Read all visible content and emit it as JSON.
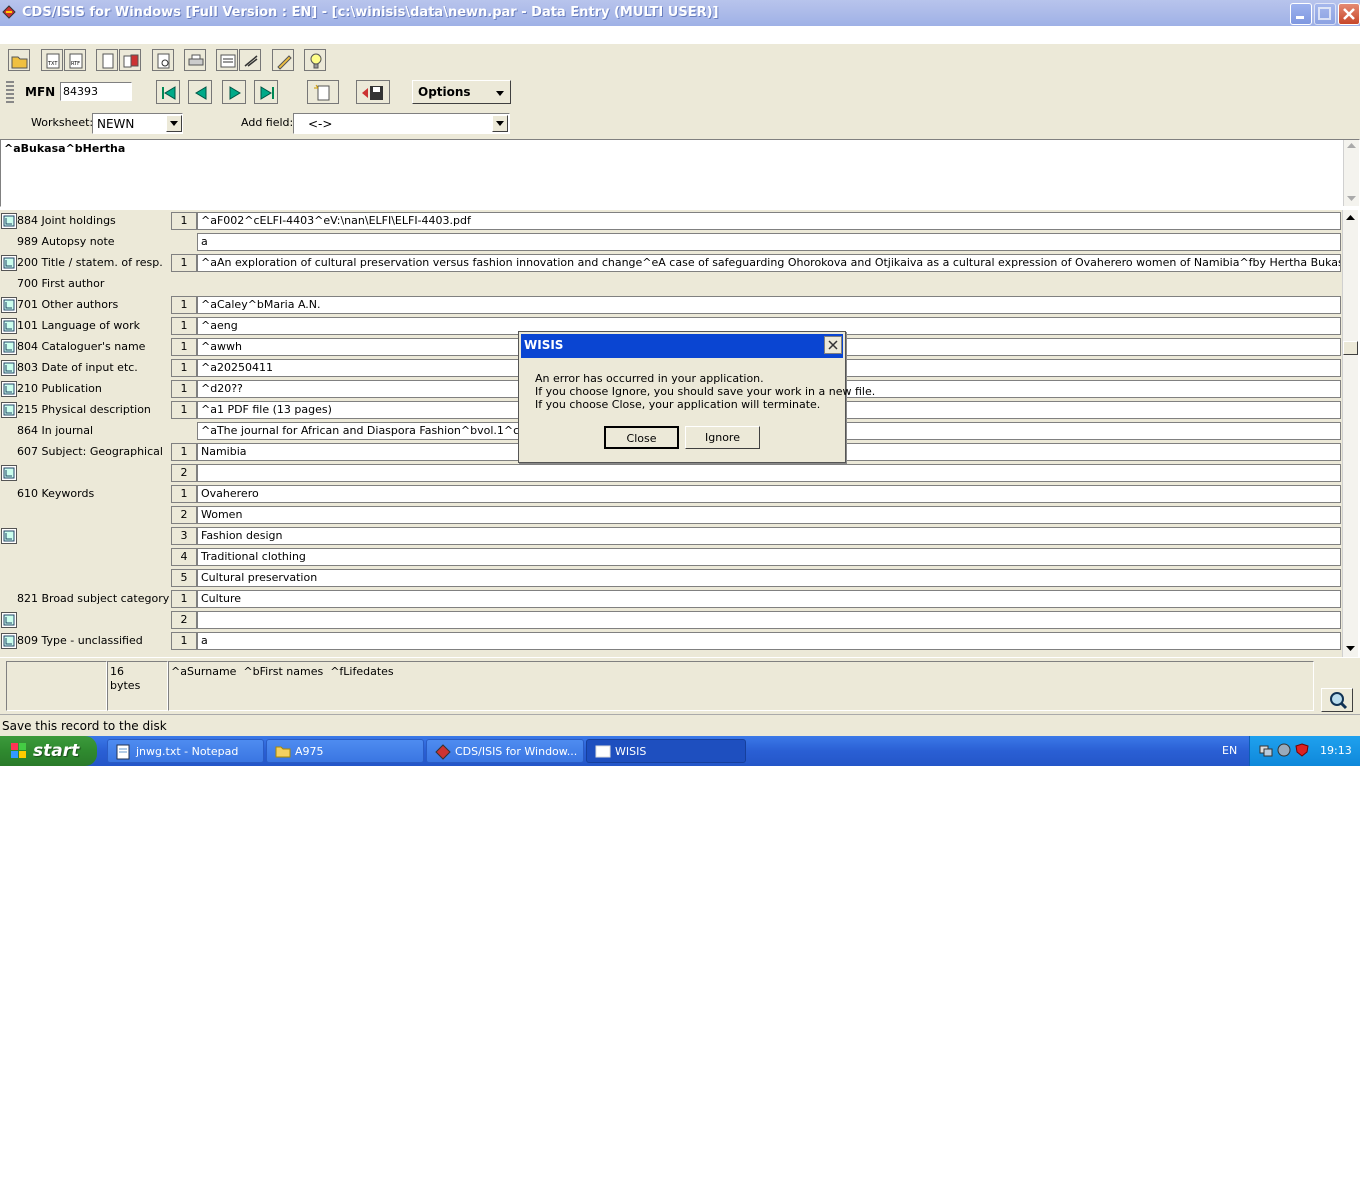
{
  "window": {
    "title": "CDS/ISIS for Windows [Full Version : EN] - [c:\\winisis\\data\\newn.par - Data Entry (MULTI USER)]"
  },
  "toolbar": {
    "mfn_label": "MFN",
    "mfn_value": "84393",
    "options_label": "Options",
    "worksheet_label": "Worksheet:",
    "worksheet_value": "NEWN",
    "addfield_label": "Add field:",
    "addfield_value": "<->"
  },
  "editor": {
    "text": "^aBukasa^bHertha"
  },
  "fields": [
    {
      "label": "884 Joint holdings",
      "occ": "1",
      "value": "^aF002^cELFI-4403^eV:\\nan\\ELFI\\ELFI-4403.pdf",
      "icon": true
    },
    {
      "label": "989 Autopsy note",
      "occ": "",
      "value": "a",
      "icon": false
    },
    {
      "label": "200 Title / statem. of resp.",
      "occ": "1",
      "value": "^aAn exploration of cultural preservation versus fashion innovation and change^eA case of safeguarding Ohorokova and Otjikaiva as a cultural expression of Ovaherero women of Namibia^fby Hertha Bukasa and Maria A.N. Caley",
      "icon": true
    },
    {
      "label": "700 First author",
      "occ": "",
      "value": "",
      "icon": false,
      "nofield": true
    },
    {
      "label": "701 Other authors",
      "occ": "1",
      "value": "^aCaley^bMaria A.N.",
      "icon": true
    },
    {
      "label": "101 Language of work",
      "occ": "1",
      "value": "^aeng",
      "icon": true
    },
    {
      "label": "804 Cataloguer's name",
      "occ": "1",
      "value": "^awwh",
      "icon": true
    },
    {
      "label": "803 Date of input etc.",
      "occ": "1",
      "value": "^a20250411",
      "icon": true
    },
    {
      "label": "210 Publication",
      "occ": "1",
      "value": "^d20??",
      "icon": true
    },
    {
      "label": "215 Physical description",
      "occ": "1",
      "value": "^a1 PDF file (13 pages)",
      "icon": true
    },
    {
      "label": "864 In journal",
      "occ": "",
      "value": "^aThe journal for African and Diaspora Fashion^bvol.1^cno.1^dp",
      "icon": false
    },
    {
      "label": "607 Subject: Geographical",
      "occ": "1",
      "value": "Namibia",
      "icon": false
    },
    {
      "label": "",
      "occ": "2",
      "value": "",
      "icon": true
    },
    {
      "label": "610 Keywords",
      "occ": "1",
      "value": "Ovaherero",
      "icon": false
    },
    {
      "label": "",
      "occ": "2",
      "value": "Women",
      "icon": false
    },
    {
      "label": "",
      "occ": "3",
      "value": "Fashion design",
      "icon": true
    },
    {
      "label": "",
      "occ": "4",
      "value": "Traditional clothing",
      "icon": false
    },
    {
      "label": "",
      "occ": "5",
      "value": "Cultural preservation",
      "icon": false
    },
    {
      "label": "821 Broad subject category",
      "occ": "1",
      "value": "Culture",
      "icon": false
    },
    {
      "label": "",
      "occ": "2",
      "value": "",
      "icon": true
    },
    {
      "label": "809 Type - unclassified",
      "occ": "1",
      "value": "a",
      "icon": true
    }
  ],
  "info": {
    "size_value": "16",
    "size_unit": "bytes",
    "hint": "^aSurname  ^bFirst names  ^fLifedates"
  },
  "status": {
    "text": "Save this record to the disk"
  },
  "dialog": {
    "title": "WISIS",
    "line1": "An error has occurred in your application.",
    "line2": "If you choose Ignore, you should save your work in a new file.",
    "line3": "If you choose Close, your application will terminate.",
    "close_label": "Close",
    "ignore_label": "Ignore"
  },
  "taskbar": {
    "start_label": "start",
    "tasks": [
      {
        "label": "jnwg.txt - Notepad"
      },
      {
        "label": "A975"
      },
      {
        "label": "CDS/ISIS for Window..."
      },
      {
        "label": "WISIS"
      }
    ],
    "language": "EN",
    "clock": "19:13"
  },
  "colors": {
    "titlebar": "#9fb1e6",
    "dialog_title": "#0a45d2",
    "taskbar": "#2a5fd4",
    "start": "#2f8a2f",
    "panel": "#ece9d8"
  }
}
